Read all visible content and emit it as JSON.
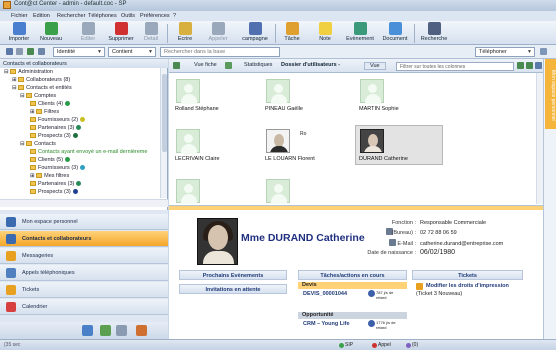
{
  "window": {
    "title": "Cont@ct Center - admin - default.coc - SP"
  },
  "menu": [
    "Fichier",
    "Edition",
    "Rechercher",
    "Téléphones",
    "Outils",
    "Préférences",
    "?"
  ],
  "toolbar": [
    {
      "label": "Importer",
      "icon": "import-icon",
      "color": "#4a7fd0"
    },
    {
      "label": "Nouveau",
      "icon": "new-contact-icon",
      "color": "#3aa04a"
    },
    {
      "label": "Editer",
      "icon": "edit-icon",
      "color": "#9aa8bb"
    },
    {
      "label": "Supprimer",
      "icon": "delete-icon",
      "color": "#d03030"
    },
    {
      "label": "Detail",
      "icon": "detail-icon",
      "color": "#9aa8bb"
    },
    {
      "label": "Ecrire",
      "icon": "write-icon",
      "color": "#d8b040"
    },
    {
      "label": "Appeler",
      "icon": "phone-icon",
      "color": "#9aa8bb"
    },
    {
      "label": "campagne",
      "icon": "campaign-icon",
      "color": "#5070b0"
    },
    {
      "label": "Tâche",
      "icon": "task-icon",
      "color": "#e0a030"
    },
    {
      "label": "Note",
      "icon": "note-icon",
      "color": "#f0d040"
    },
    {
      "label": "Evènement",
      "icon": "event-icon",
      "color": "#3a9a7a"
    },
    {
      "label": "Document",
      "icon": "document-icon",
      "color": "#4a90d8"
    },
    {
      "label": "Recherche",
      "icon": "search-binoculars-icon",
      "color": "#506080"
    }
  ],
  "filter": {
    "identity": "Identité",
    "content": "Contient",
    "search_placeholder": "Rechercher dans la base",
    "phone": "Téléphoner"
  },
  "left": {
    "header": "Contacts et collaborateurs",
    "tree": [
      {
        "label": "Administration",
        "level": 0
      },
      {
        "label": "Collaborateurs (8)",
        "level": 1
      },
      {
        "label": "Contacts et entités",
        "level": 1
      },
      {
        "label": "Comptes",
        "level": 2
      },
      {
        "label": "Clients (4)",
        "level": 3,
        "dot": "#2a9a4a"
      },
      {
        "label": "Filtres",
        "level": 3
      },
      {
        "label": "Fournisseurs (2)",
        "level": 3,
        "dot": "#c8c020"
      },
      {
        "label": "Partenaires (3)",
        "level": 3,
        "dot": "#2a8a5a"
      },
      {
        "label": "Prospects (3)",
        "level": 3,
        "dot": "#1f6f3f"
      },
      {
        "label": "Contacts",
        "level": 2
      },
      {
        "label": "Contacts ayant envoyé un e-mail dernièreme",
        "level": 3,
        "green": true
      },
      {
        "label": "Clients (5)",
        "level": 3,
        "dot": "#2a9a4a"
      },
      {
        "label": "Fournisseurs (3)",
        "level": 3,
        "dot": "#30a0c0"
      },
      {
        "label": "Mes filtres",
        "level": 3
      },
      {
        "label": "Partenaires (3)",
        "level": 3,
        "dot": "#2a8a5a"
      },
      {
        "label": "Prospects (3)",
        "level": 3,
        "dot": "#1f3f8f"
      }
    ],
    "nav": [
      {
        "label": "Mon espace personnel",
        "color": "#3a6ab0"
      },
      {
        "label": "Contacts et collaborateurs",
        "color": "#3a6ab0",
        "active": true
      },
      {
        "label": "Messageries",
        "color": "#e8a020"
      },
      {
        "label": "Appels téléphoniques",
        "color": "#5080c0"
      },
      {
        "label": "Tickets",
        "color": "#e8a020"
      },
      {
        "label": "Calendrier",
        "color": "#d84040"
      }
    ]
  },
  "main": {
    "tabs": [
      "Vue fiche",
      "Statistiques",
      "Dossier d'utilisateurs -"
    ],
    "view_label": "Vue",
    "filter_placeholder": "Filtrer sur toutes les colonnes",
    "cards": [
      {
        "name": "Rolland Stéphane",
        "photo": false
      },
      {
        "name": "PINEAU Gaëlle",
        "photo": false
      },
      {
        "name": "MARTIN Sophie",
        "photo": false
      },
      {
        "name": "LECRIVAIN Claire",
        "photo": false
      },
      {
        "name": "LE LOUARN Florent",
        "photo": true,
        "extra": "Ro"
      },
      {
        "name": "DURAND Catherine",
        "photo": true,
        "selected": true
      },
      {
        "name": "",
        "photo": false
      },
      {
        "name": "",
        "photo": false
      }
    ],
    "detail": {
      "name": "Mme DURAND Catherine",
      "fields": [
        {
          "label": "Fonction :",
          "value": "Responsable Commerciale"
        },
        {
          "label": "(Bureau) :",
          "value": "02 72 88 06 59"
        },
        {
          "label": "E-Mail :",
          "value": "catherine.durand@entreprise.com"
        },
        {
          "label": "Date de naissance :",
          "value": "06/02/1980"
        }
      ],
      "left_buttons": [
        "Prochains Evènements",
        "Invitations en attente"
      ],
      "tasks_title": "Tâches/actions en cours",
      "devis": {
        "section": "Devis",
        "ref": "DEVIS_00001044",
        "late": "787 j/s de retard"
      },
      "opportunite": {
        "section": "Opportunité",
        "name": "CRM – Young Life",
        "late": "1776 j/s de retard"
      },
      "tickets_title": "Tickets",
      "ticket": {
        "title": "Modifier les droits d'impression",
        "sub": "(Ticket 3 Nouveau)"
      }
    }
  },
  "right_strip": "Mon espace personnel",
  "status": {
    "left": "(35 sec",
    "items": [
      "SIP",
      "Appel",
      "(0)"
    ]
  }
}
